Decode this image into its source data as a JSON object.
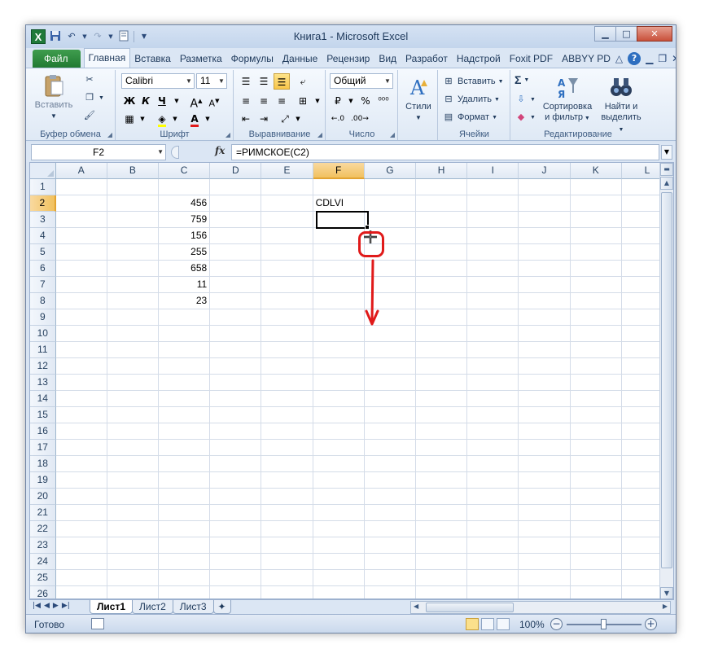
{
  "window": {
    "title": "Книга1 - Microsoft Excel",
    "min_icon": "minimize-icon",
    "max_icon": "maximize-icon",
    "close_icon": "close-icon"
  },
  "qat": {
    "logo": "X",
    "icons": [
      "save-icon",
      "undo-icon",
      "redo-icon",
      "print-preview-icon",
      "customize-qat-icon"
    ]
  },
  "tabs": {
    "file": "Файл",
    "items": [
      "Главная",
      "Вставка",
      "Разметка",
      "Формулы",
      "Данные",
      "Рецензир",
      "Вид",
      "Разработ",
      "Надстрой",
      "Foxit PDF",
      "ABBYY PD"
    ],
    "active": "Главная",
    "help": "?"
  },
  "ribbon": {
    "clipboard": {
      "label": "Буфер обмена",
      "paste": "Вставить"
    },
    "font": {
      "label": "Шрифт",
      "name": "Calibri",
      "size": "11",
      "bold": "Ж",
      "italic": "К",
      "underline": "Ч"
    },
    "alignment": {
      "label": "Выравнивание"
    },
    "number": {
      "label": "Число",
      "format": "Общий",
      "percent": "%"
    },
    "styles": {
      "label": "Стили"
    },
    "cells": {
      "label": "Ячейки",
      "insert": "Вставить",
      "delete": "Удалить",
      "format": "Формат"
    },
    "editing": {
      "label": "Редактирование",
      "sum": "Σ",
      "sort_line1": "Сортировка",
      "sort_line2": "и фильтр",
      "find_line1": "Найти и",
      "find_line2": "выделить"
    }
  },
  "formula_bar": {
    "name_box": "F2",
    "fx": "fx",
    "formula": "=РИМСКОЕ(C2)"
  },
  "grid": {
    "columns": [
      "A",
      "B",
      "C",
      "D",
      "E",
      "F",
      "G",
      "H",
      "I",
      "J",
      "K",
      "L"
    ],
    "selected_column": "F",
    "selected_row": "2",
    "rows": [
      {
        "n": "1",
        "C": "",
        "F": ""
      },
      {
        "n": "2",
        "C": "456",
        "F": "CDLVI"
      },
      {
        "n": "3",
        "C": "759",
        "F": ""
      },
      {
        "n": "4",
        "C": "156",
        "F": ""
      },
      {
        "n": "5",
        "C": "255",
        "F": ""
      },
      {
        "n": "6",
        "C": "658",
        "F": ""
      },
      {
        "n": "7",
        "C": "11",
        "F": ""
      },
      {
        "n": "8",
        "C": "23",
        "F": ""
      },
      {
        "n": "9",
        "C": "",
        "F": ""
      },
      {
        "n": "10",
        "C": "",
        "F": ""
      },
      {
        "n": "11",
        "C": "",
        "F": ""
      },
      {
        "n": "12",
        "C": "",
        "F": ""
      },
      {
        "n": "13",
        "C": "",
        "F": ""
      },
      {
        "n": "14",
        "C": "",
        "F": ""
      },
      {
        "n": "15",
        "C": "",
        "F": ""
      },
      {
        "n": "16",
        "C": "",
        "F": ""
      },
      {
        "n": "17",
        "C": "",
        "F": ""
      },
      {
        "n": "18",
        "C": "",
        "F": ""
      },
      {
        "n": "19",
        "C": "",
        "F": ""
      },
      {
        "n": "20",
        "C": "",
        "F": ""
      },
      {
        "n": "21",
        "C": "",
        "F": ""
      },
      {
        "n": "22",
        "C": "",
        "F": ""
      },
      {
        "n": "23",
        "C": "",
        "F": ""
      },
      {
        "n": "24",
        "C": "",
        "F": ""
      },
      {
        "n": "25",
        "C": "",
        "F": ""
      },
      {
        "n": "26",
        "C": "",
        "F": ""
      }
    ],
    "annotation_color": "#e01a1a"
  },
  "sheets": {
    "tabs": [
      "Лист1",
      "Лист2",
      "Лист3"
    ],
    "active": "Лист1",
    "new_sheet_icon": "insert-sheet-icon"
  },
  "status": {
    "text": "Готово",
    "zoom": "100%"
  }
}
